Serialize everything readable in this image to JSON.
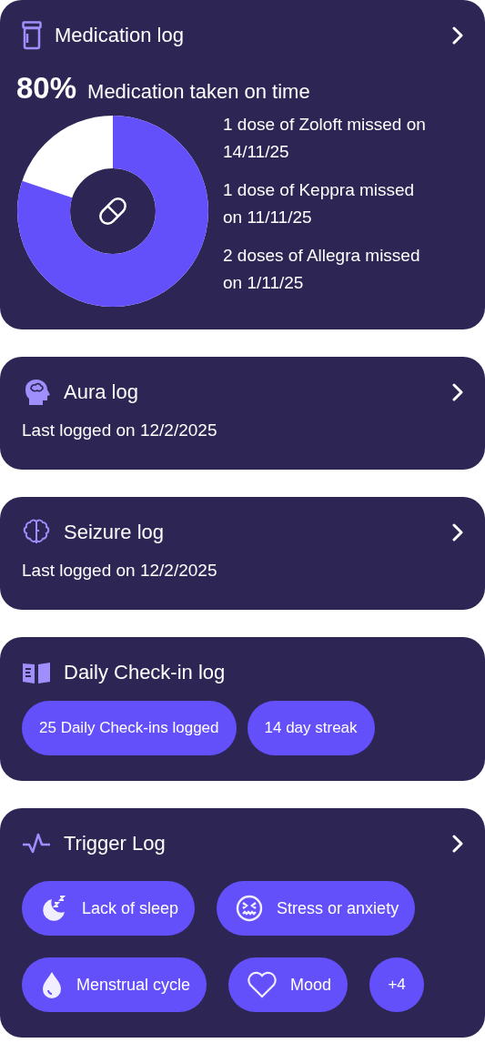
{
  "cards": [
    {
      "kind": "medication",
      "title": "Medication log",
      "chevron": true,
      "stat": {
        "value": "80%",
        "label": "Medication taken on time",
        "level": 0.8
      },
      "missed": [
        "1 dose of Zoloft missed on 14/11/25",
        "1 dose of Keppra missed on 11/11/25",
        "2 doses of Allegra missed on 1/11/25"
      ]
    },
    {
      "kind": "logged",
      "title": "Aura log",
      "chevron": true,
      "text": "Last logged on 12/2/2025"
    },
    {
      "kind": "logged",
      "title": "Seizure log",
      "chevron": true,
      "text": "Last logged on 12/2/2025"
    },
    {
      "kind": "pills",
      "title": "Daily Check-in log",
      "chevron": false,
      "pills": [
        "25 Daily Check-ins logged",
        "14 day streak"
      ]
    },
    {
      "kind": "triggers",
      "title": "Trigger Log",
      "chevron": true,
      "triggers": [
        {
          "kind": "chip",
          "label": "Lack of sleep"
        },
        {
          "kind": "chip",
          "label": "Stress or anxiety"
        },
        {
          "kind": "chip",
          "label": "Menstrual cycle"
        },
        {
          "kind": "chip",
          "label": "Mood"
        },
        {
          "kind": "count",
          "label": "+4"
        }
      ]
    }
  ]
}
